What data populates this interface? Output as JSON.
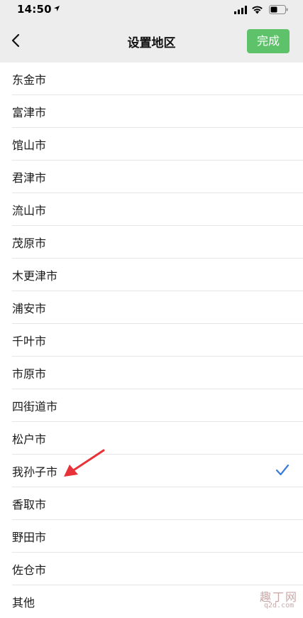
{
  "status_bar": {
    "time": "14:50"
  },
  "nav": {
    "title": "设置地区",
    "done_label": "完成"
  },
  "list": {
    "items": [
      {
        "label": "东金市",
        "selected": false
      },
      {
        "label": "富津市",
        "selected": false
      },
      {
        "label": "馆山市",
        "selected": false
      },
      {
        "label": "君津市",
        "selected": false
      },
      {
        "label": "流山市",
        "selected": false
      },
      {
        "label": "茂原市",
        "selected": false
      },
      {
        "label": "木更津市",
        "selected": false
      },
      {
        "label": "浦安市",
        "selected": false
      },
      {
        "label": "千叶市",
        "selected": false
      },
      {
        "label": "市原市",
        "selected": false
      },
      {
        "label": "四街道市",
        "selected": false
      },
      {
        "label": "松户市",
        "selected": false
      },
      {
        "label": "我孙子市",
        "selected": true
      },
      {
        "label": "香取市",
        "selected": false
      },
      {
        "label": "野田市",
        "selected": false
      },
      {
        "label": "佐仓市",
        "selected": false
      },
      {
        "label": "其他",
        "selected": false
      }
    ]
  },
  "watermark": {
    "text": "趣丁网",
    "url": "q2d.com"
  },
  "colors": {
    "accent_green": "#5ec26a",
    "check_blue": "#3b7bd8",
    "arrow_red": "#e8323a",
    "nav_bg": "#ededed"
  }
}
